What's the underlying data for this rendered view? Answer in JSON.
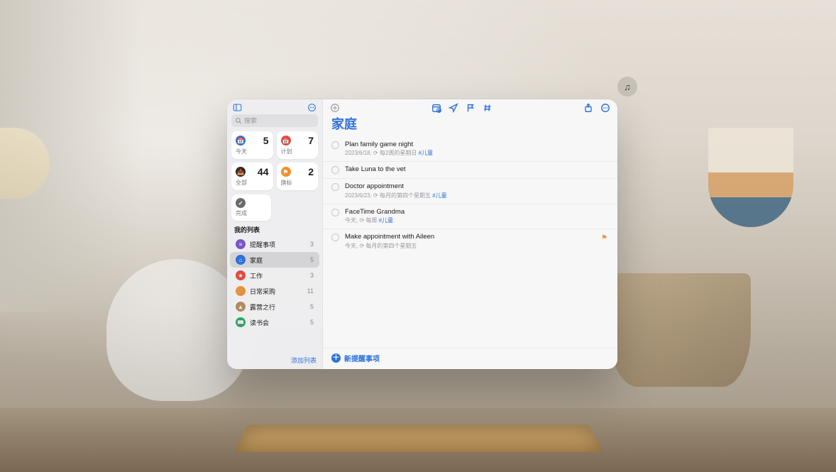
{
  "env": {
    "glyph_button_label": "♫"
  },
  "sidebar": {
    "search_placeholder": "搜索",
    "smart": [
      {
        "id": "today",
        "label": "今天",
        "count": 5,
        "color": "blue",
        "glyph": "📅"
      },
      {
        "id": "scheduled",
        "label": "计划",
        "count": 7,
        "color": "red",
        "glyph": "📅"
      },
      {
        "id": "all",
        "label": "全部",
        "count": 44,
        "color": "black",
        "glyph": "📥"
      },
      {
        "id": "flagged",
        "label": "旗标",
        "count": 2,
        "color": "orange",
        "glyph": "⚑"
      }
    ],
    "done": {
      "label": "完成",
      "glyph": "✓"
    },
    "section_title": "我的列表",
    "lists": [
      {
        "id": "reminders",
        "label": "提醒事项",
        "count": 3,
        "color": "purple",
        "glyph": "≡",
        "selected": false
      },
      {
        "id": "family",
        "label": "家庭",
        "count": 5,
        "color": "blue",
        "glyph": "⌂",
        "selected": true
      },
      {
        "id": "work",
        "label": "工作",
        "count": 3,
        "color": "red",
        "glyph": "★",
        "selected": false
      },
      {
        "id": "groceries",
        "label": "日常采购",
        "count": 11,
        "color": "orange",
        "glyph": "🛒",
        "selected": false
      },
      {
        "id": "camping",
        "label": "露营之行",
        "count": 5,
        "color": "brown",
        "glyph": "▲",
        "selected": false
      },
      {
        "id": "bookclub",
        "label": "读书会",
        "count": 5,
        "color": "green",
        "glyph": "📖",
        "selected": false
      }
    ],
    "add_list_label": "添加列表"
  },
  "main": {
    "title": "家庭",
    "reminders": [
      {
        "title": "Plan family game night",
        "sub": "2023/6/18, ⟳ 每2周的星期日 ",
        "tag": "#儿童",
        "flag": false
      },
      {
        "title": "Take Luna to the vet",
        "sub": "",
        "tag": "",
        "flag": false
      },
      {
        "title": "Doctor appointment",
        "sub": "2023/6/23, ⟳ 每月的第四个星期五 ",
        "tag": "#儿童",
        "flag": false
      },
      {
        "title": "FaceTime Grandma",
        "sub": "今天, ⟳ 每周 ",
        "tag": "#儿童",
        "flag": false
      },
      {
        "title": "Make appointment with Aileen",
        "sub": "今天, ⟳ 每月的第四个星期五",
        "tag": "",
        "flag": true
      }
    ],
    "new_reminder_label": "新提醒事项"
  }
}
